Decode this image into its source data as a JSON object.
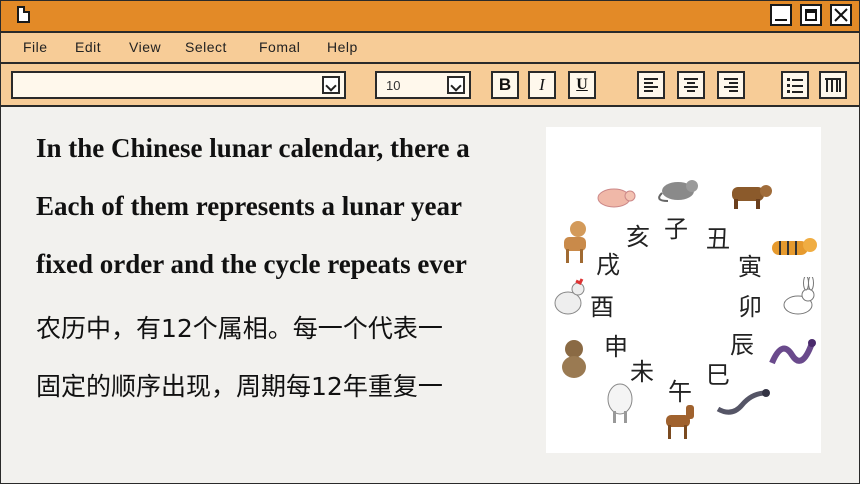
{
  "menu": [
    "File",
    "Edit",
    "View",
    "Select",
    "Fomal",
    "Help"
  ],
  "toolbar": {
    "font_value": "",
    "size_value": "10",
    "bold_label": "B",
    "italic_label": "I",
    "underline_label": "U"
  },
  "document": {
    "lines": [
      "In the Chinese lunar calendar, there a",
      "Each of them represents a lunar year",
      "fixed order and the cycle repeats ever",
      "农历中，有12个属相。每一个代表一",
      "固定的顺序出现，周期每12年重复一"
    ]
  },
  "zodiac_image": {
    "branches": [
      "子",
      "丑",
      "寅",
      "卯",
      "辰",
      "巳",
      "午",
      "未",
      "申",
      "酉",
      "戌",
      "亥"
    ],
    "animals": [
      "rat-icon",
      "ox-icon",
      "tiger-icon",
      "rabbit-icon",
      "dragon-icon",
      "snake-icon",
      "horse-icon",
      "goat-icon",
      "monkey-icon",
      "rooster-icon",
      "dog-icon",
      "pig-icon"
    ]
  },
  "colors": {
    "titlebar": "#e38a27",
    "menubar": "#f7cc97",
    "page": "#f2f1ee"
  }
}
